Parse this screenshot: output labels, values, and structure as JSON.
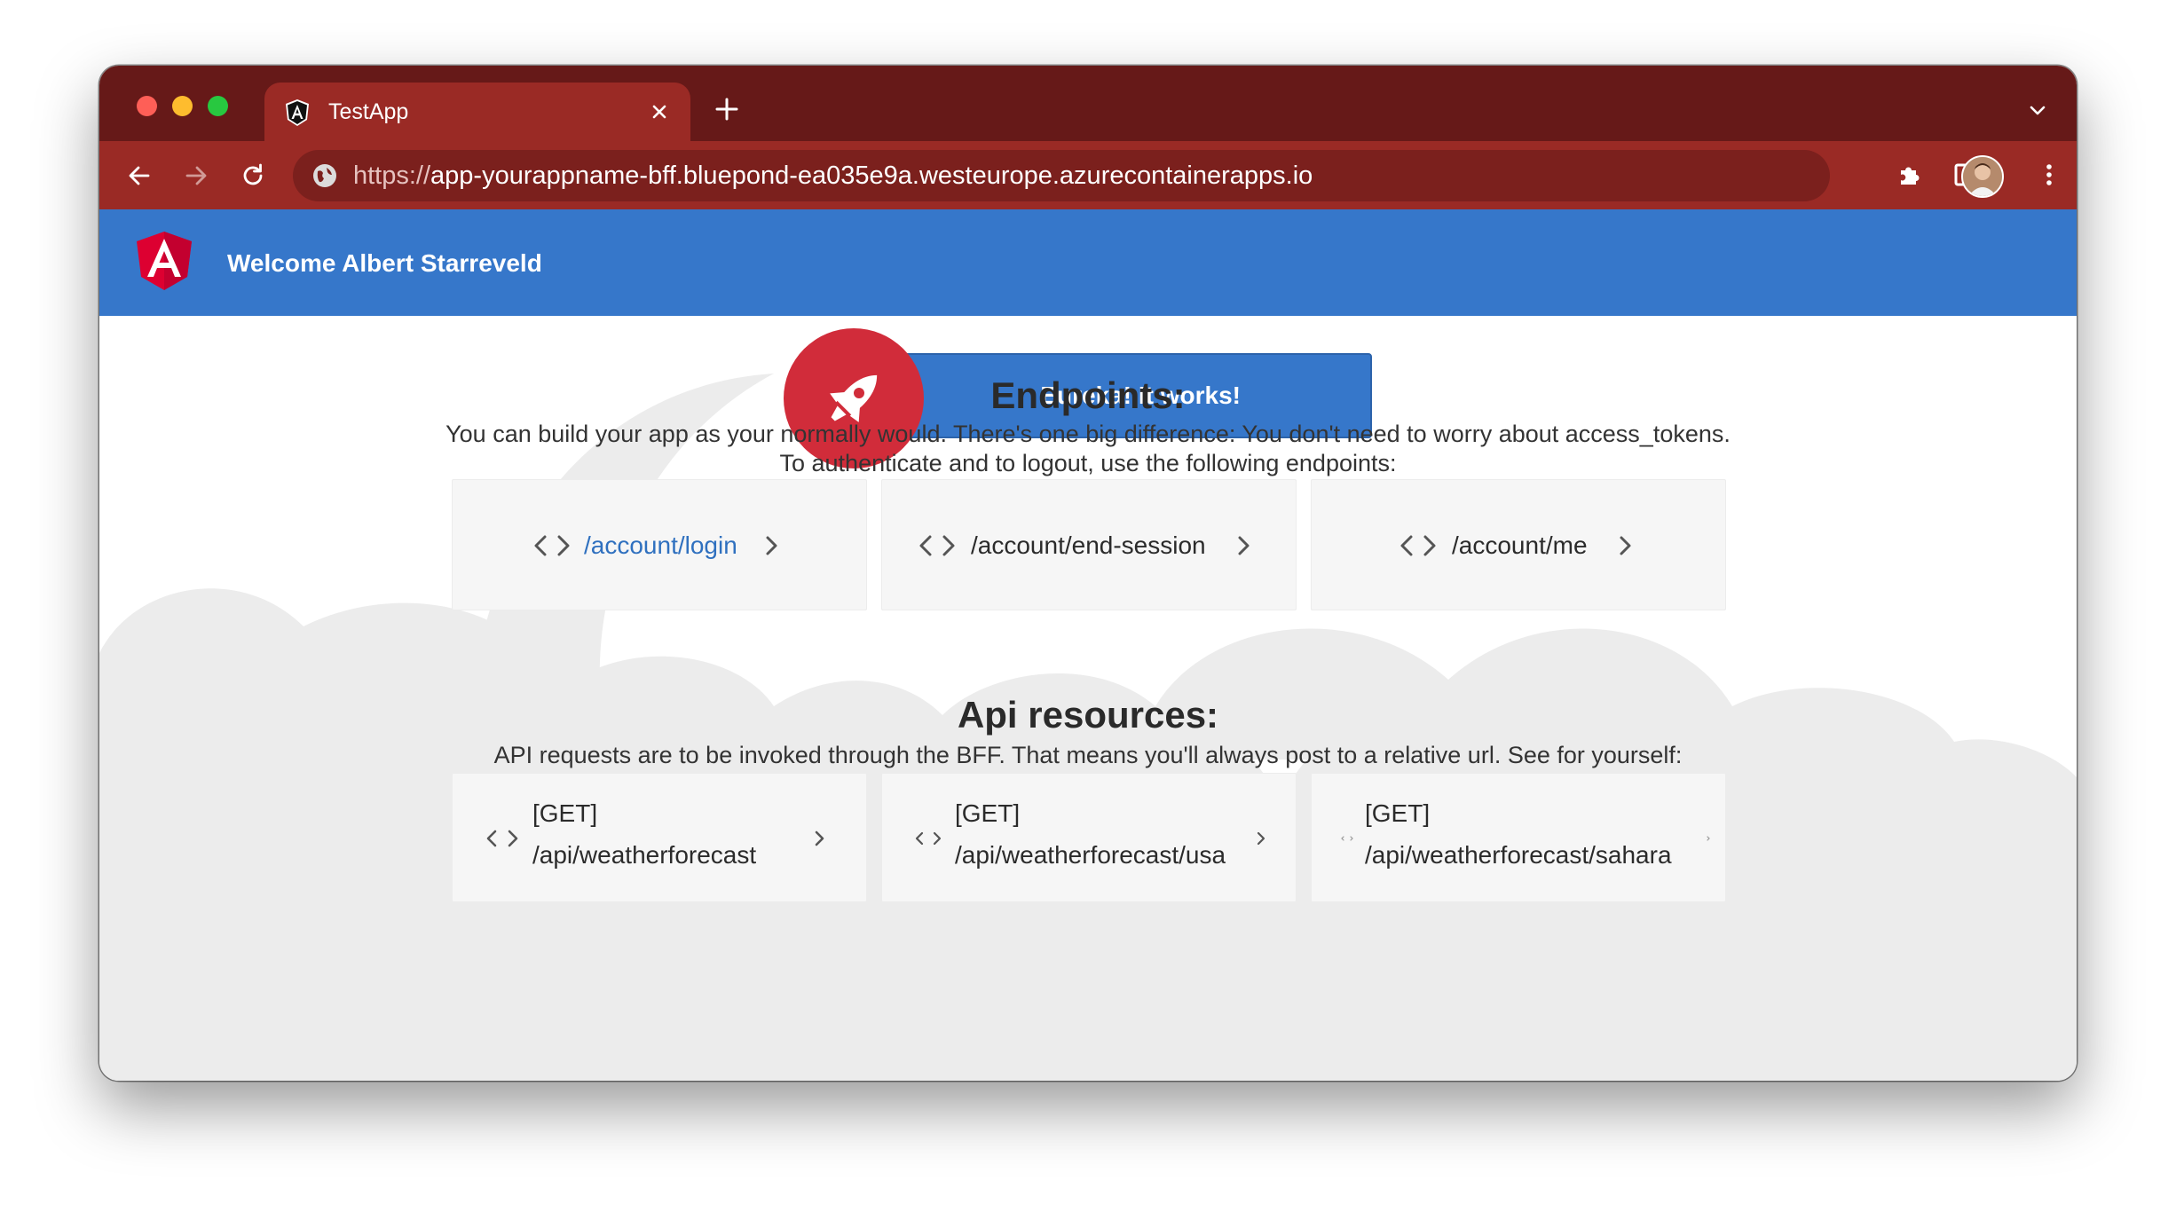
{
  "browser": {
    "tab_title": "TestApp",
    "url_scheme": "https://",
    "url_rest": "app-yourappname-bff.bluepond-ea035e9a.westeurope.azurecontainerapps.io",
    "colors": {
      "frame": "#661918",
      "toolbar": "#9a2a25",
      "omnibox": "#7b201d"
    }
  },
  "app": {
    "welcome": "Welcome Albert Starreveld",
    "eureka_button": "Eureka! It works!",
    "brand_color": "#3677ca",
    "rocket_color": "#d12c3a"
  },
  "endpoints": {
    "heading": "Endpoints:",
    "description_line1": "You can build your app as your normally would. There's one big difference: You don't need to worry about access_tokens.",
    "description_line2": "To authenticate and to logout, use the following endpoints:",
    "items": [
      {
        "label": "/account/login",
        "icon": "code-icon"
      },
      {
        "label": "/account/end-session",
        "icon": "code-icon"
      },
      {
        "label": "/account/me",
        "icon": "code-icon"
      }
    ]
  },
  "api": {
    "heading": "Api resources:",
    "description": "API requests are to be invoked through the BFF. That means you'll always post to a relative url. See for yourself:",
    "items": [
      {
        "method": "[GET]",
        "path": "/api/weatherforecast"
      },
      {
        "method": "[GET]",
        "path": "/api/weatherforecast/usa"
      },
      {
        "method": "[GET]",
        "path": "/api/weatherforecast/sahara"
      }
    ]
  }
}
